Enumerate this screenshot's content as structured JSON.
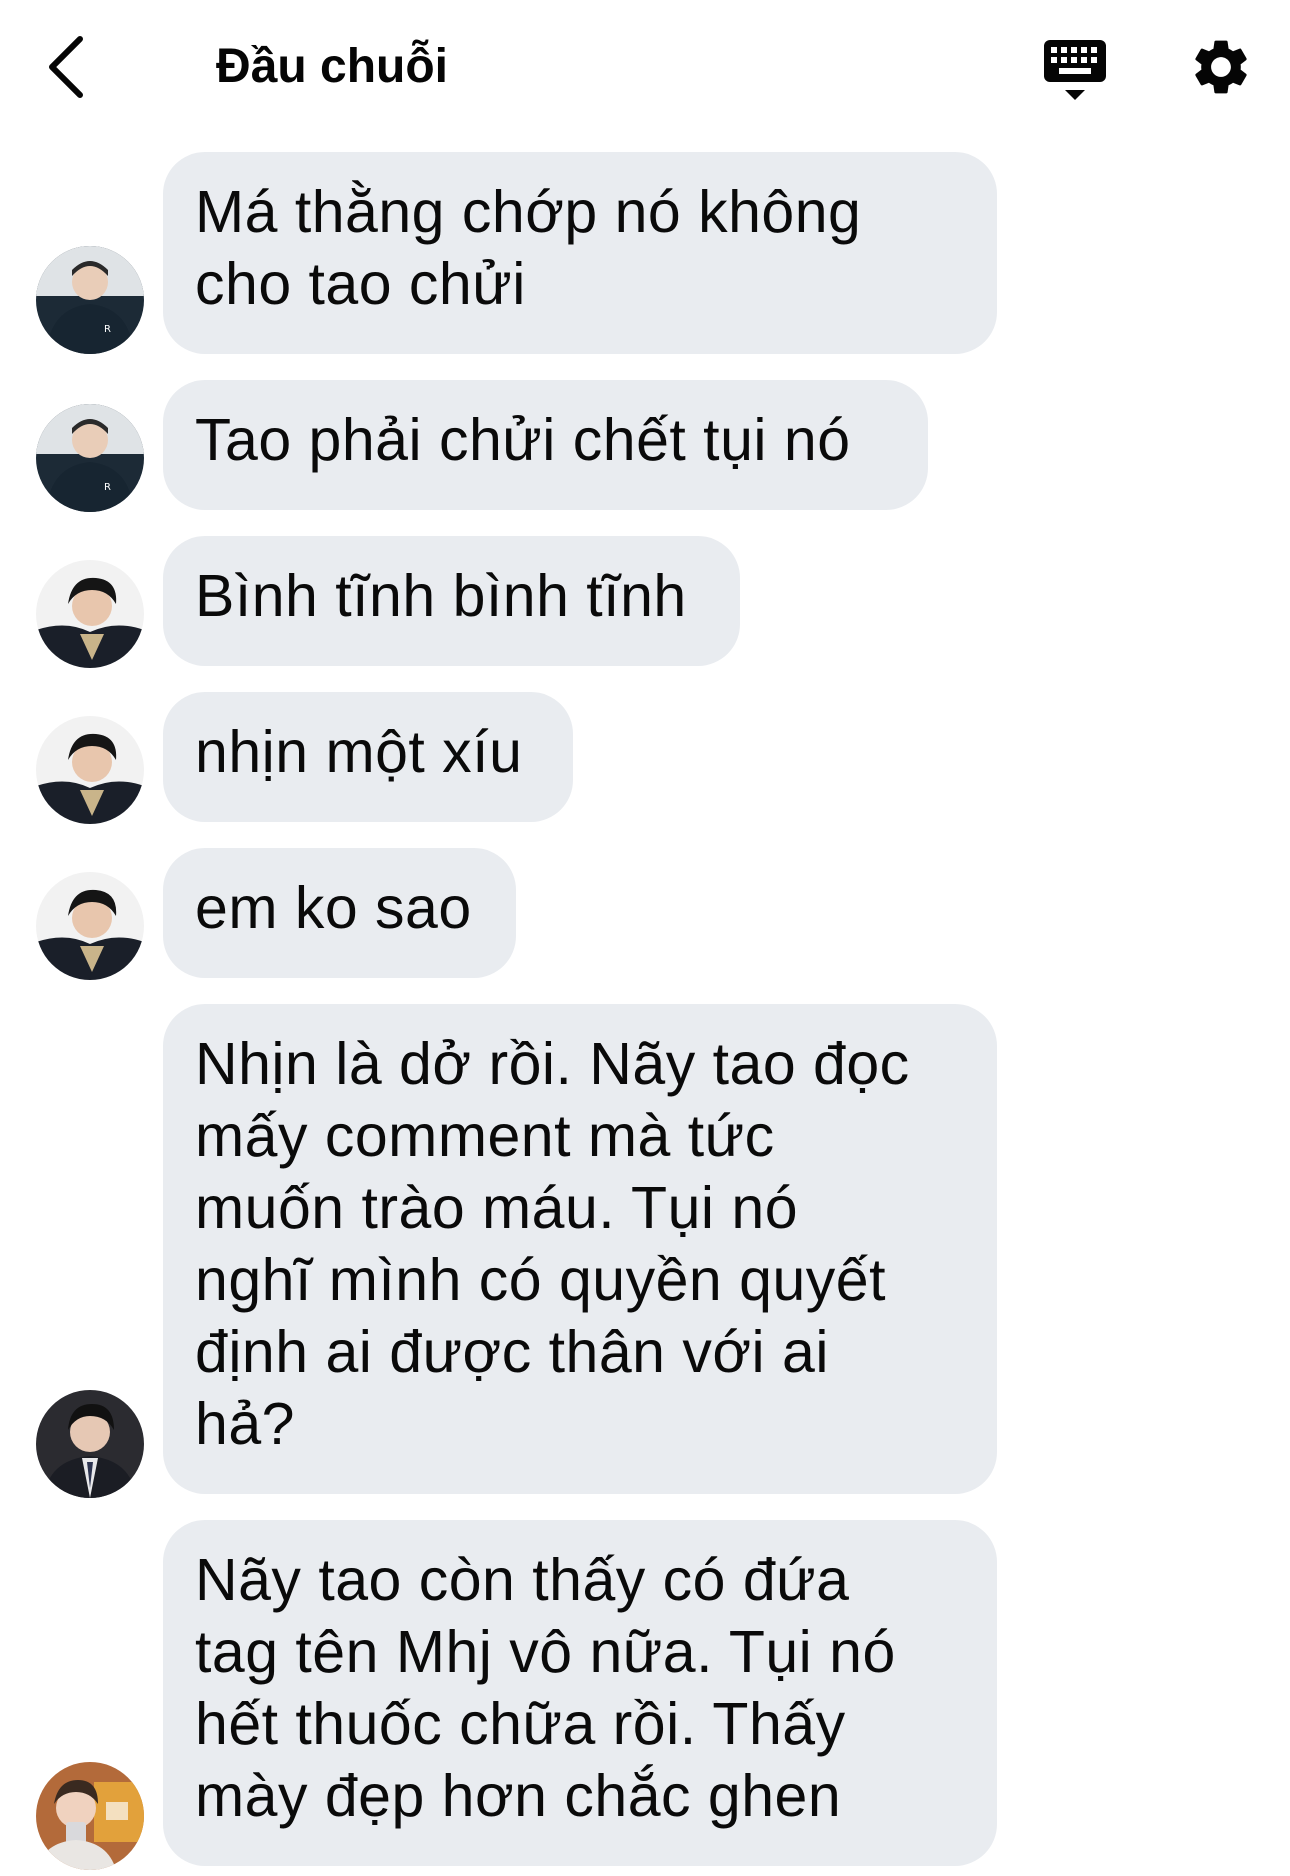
{
  "header": {
    "title": "Đầu chuỗi"
  },
  "icons": {
    "back": "chevron-left-icon",
    "keyboard": "keyboard-icon",
    "settings": "gear-icon"
  },
  "messages": [
    {
      "text": "Má thằng chớp nó không\ncho tao chửi"
    },
    {
      "text": "Tao phải chửi chết tụi nó"
    },
    {
      "text": "Bình tĩnh bình tĩnh"
    },
    {
      "text": "nhịn một xíu"
    },
    {
      "text": "em ko sao"
    },
    {
      "text": "Nhịn là dở rồi. Nãy tao đọc\nmấy comment mà tức\nmuốn trào máu. Tụi nó\nnghĩ mình có quyền quyết\nđịnh ai được thân với ai\nhả?"
    },
    {
      "text": "Nãy tao còn thấy có đứa\ntag tên Mhj vô nữa. Tụi nó\nhết thuốc chữa rồi. Thấy\nmày đẹp hơn chắc ghen"
    }
  ],
  "colors": {
    "bubble": "#e9ecf0",
    "text": "#050505",
    "background": "#ffffff"
  }
}
